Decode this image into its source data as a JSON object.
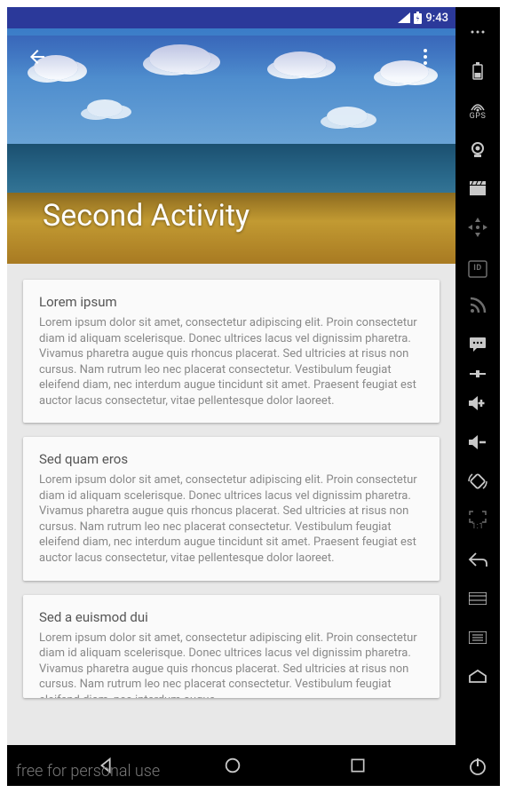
{
  "statusBar": {
    "time": "9:43"
  },
  "hero": {
    "title": "Second Activity"
  },
  "cards": [
    {
      "title": "Lorem ipsum",
      "body": "Lorem ipsum dolor sit amet, consectetur adipiscing elit. Proin consectetur diam id aliquam scelerisque. Donec ultrices lacus vel dignissim pharetra. Vivamus pharetra augue quis rhoncus placerat. Sed ultricies at risus non cursus. Nam rutrum leo nec placerat consectetur. Vestibulum feugiat eleifend diam, nec interdum augue tincidunt sit amet. Praesent feugiat est auctor lacus consectetur, vitae pellentesque dolor laoreet."
    },
    {
      "title": "Sed quam eros",
      "body": "Lorem ipsum dolor sit amet, consectetur adipiscing elit. Proin consectetur diam id aliquam scelerisque. Donec ultrices lacus vel dignissim pharetra. Vivamus pharetra augue quis rhoncus placerat. Sed ultricies at risus non cursus. Nam rutrum leo nec placerat consectetur. Vestibulum feugiat eleifend diam, nec interdum augue tincidunt sit amet. Praesent feugiat est auctor lacus consectetur, vitae pellentesque dolor laoreet."
    },
    {
      "title": "Sed a euismod dui",
      "body": "Lorem ipsum dolor sit amet, consectetur adipiscing elit. Proin consectetur diam id aliquam scelerisque. Donec ultrices lacus vel dignissim pharetra. Vivamus pharetra augue quis rhoncus placerat. Sed ultricies at risus non cursus. Nam rutrum leo nec placerat consectetur. Vestibulum feugiat eleifend diam, nec interdum augue"
    }
  ],
  "railLabels": {
    "gps": "GPS",
    "id": "ID",
    "ratio": "1:1"
  },
  "watermark": "free for personal use"
}
